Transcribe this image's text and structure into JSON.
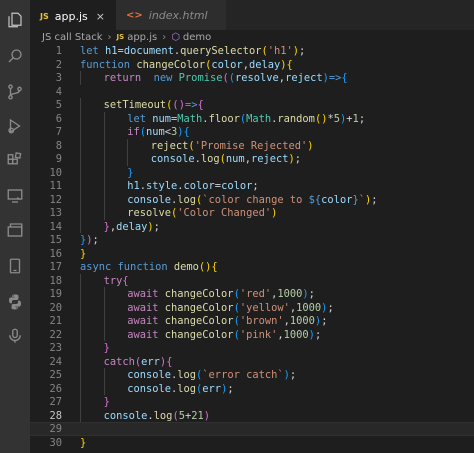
{
  "tabs": [
    {
      "label": "app.js",
      "icon": "JS",
      "close": "×",
      "active": true
    },
    {
      "label": "index.html",
      "icon": "<>",
      "active": false
    }
  ],
  "breadcrumb": {
    "folder": "JS call Stack",
    "sep": "›",
    "file_icon": "JS",
    "file": "app.js",
    "symbol": "demo"
  },
  "activity_icons": [
    "files-icon",
    "search-icon",
    "source-control-icon",
    "run-debug-icon",
    "extensions-icon",
    "remote-explorer-icon",
    "docker-icon",
    "device-icon",
    "python-icon",
    "microphone-icon"
  ],
  "editor": {
    "current_line": 28,
    "lines": [
      {
        "n": 1,
        "indent": 0,
        "tokens": [
          [
            "k",
            "let "
          ],
          [
            "v",
            "h1"
          ],
          [
            "p",
            "="
          ],
          [
            "v",
            "document"
          ],
          [
            "p",
            "."
          ],
          [
            "f",
            "querySelector"
          ],
          [
            "y",
            "("
          ],
          [
            "s",
            "'h1'"
          ],
          [
            "y",
            ")"
          ],
          [
            "p",
            ";"
          ]
        ]
      },
      {
        "n": 2,
        "indent": 0,
        "tokens": [
          [
            "k",
            "function "
          ],
          [
            "f",
            "changeColor"
          ],
          [
            "y",
            "("
          ],
          [
            "v",
            "color"
          ],
          [
            "p",
            ","
          ],
          [
            "v",
            "delay"
          ],
          [
            "y",
            ")"
          ],
          [
            "y",
            "{"
          ]
        ]
      },
      {
        "n": 3,
        "indent": 1,
        "tokens": [
          [
            "c",
            "return  "
          ],
          [
            "k",
            "new "
          ],
          [
            "t",
            "Promise"
          ],
          [
            "pm",
            "("
          ],
          [
            "bl",
            "("
          ],
          [
            "v",
            "resolve"
          ],
          [
            "p",
            ","
          ],
          [
            "v",
            "reject"
          ],
          [
            "bl",
            ")"
          ],
          [
            "k",
            "=>"
          ],
          [
            "bl",
            "{"
          ]
        ]
      },
      {
        "n": 4,
        "indent": 0,
        "tokens": []
      },
      {
        "n": 5,
        "indent": 1,
        "tokens": [
          [
            "f",
            "setTimeout"
          ],
          [
            "y",
            "("
          ],
          [
            "pm",
            "("
          ],
          [
            "pm",
            ")"
          ],
          [
            "k",
            "=>"
          ],
          [
            "pm",
            "{"
          ]
        ]
      },
      {
        "n": 6,
        "indent": 2,
        "tokens": [
          [
            "k",
            "let "
          ],
          [
            "v",
            "num"
          ],
          [
            "p",
            "="
          ],
          [
            "t",
            "Math"
          ],
          [
            "p",
            "."
          ],
          [
            "f",
            "floor"
          ],
          [
            "bl",
            "("
          ],
          [
            "t",
            "Math"
          ],
          [
            "p",
            "."
          ],
          [
            "f",
            "random"
          ],
          [
            "y",
            "("
          ],
          [
            "y",
            ")"
          ],
          [
            "p",
            "*"
          ],
          [
            "n",
            "5"
          ],
          [
            "bl",
            ")"
          ],
          [
            "p",
            "+"
          ],
          [
            "n",
            "1"
          ],
          [
            "p",
            ";"
          ]
        ]
      },
      {
        "n": 7,
        "indent": 2,
        "tokens": [
          [
            "c",
            "if"
          ],
          [
            "bl",
            "("
          ],
          [
            "v",
            "num"
          ],
          [
            "p",
            "<"
          ],
          [
            "n",
            "3"
          ],
          [
            "bl",
            ")"
          ],
          [
            "bl",
            "{"
          ]
        ]
      },
      {
        "n": 8,
        "indent": 3,
        "tokens": [
          [
            "f",
            "reject"
          ],
          [
            "y",
            "("
          ],
          [
            "s",
            "'Promise Rejected'"
          ],
          [
            "y",
            ")"
          ]
        ]
      },
      {
        "n": 9,
        "indent": 3,
        "tokens": [
          [
            "v",
            "console"
          ],
          [
            "p",
            "."
          ],
          [
            "f",
            "log"
          ],
          [
            "y",
            "("
          ],
          [
            "v",
            "num"
          ],
          [
            "p",
            ","
          ],
          [
            "v",
            "reject"
          ],
          [
            "y",
            ")"
          ],
          [
            "p",
            ";"
          ]
        ]
      },
      {
        "n": 10,
        "indent": 2,
        "tokens": [
          [
            "bl",
            "}"
          ]
        ]
      },
      {
        "n": 11,
        "indent": 2,
        "tokens": [
          [
            "v",
            "h1"
          ],
          [
            "p",
            "."
          ],
          [
            "v",
            "style"
          ],
          [
            "p",
            "."
          ],
          [
            "v",
            "color"
          ],
          [
            "p",
            "="
          ],
          [
            "v",
            "color"
          ],
          [
            "p",
            ";"
          ]
        ]
      },
      {
        "n": 12,
        "indent": 2,
        "tokens": [
          [
            "v",
            "console"
          ],
          [
            "p",
            "."
          ],
          [
            "f",
            "log"
          ],
          [
            "y",
            "("
          ],
          [
            "s",
            "`color change to "
          ],
          [
            "k",
            "${"
          ],
          [
            "v",
            "color"
          ],
          [
            "k",
            "}"
          ],
          [
            "s",
            "`"
          ],
          [
            "y",
            ")"
          ],
          [
            "p",
            ";"
          ]
        ]
      },
      {
        "n": 13,
        "indent": 2,
        "tokens": [
          [
            "f",
            "resolve"
          ],
          [
            "y",
            "("
          ],
          [
            "s",
            "'Color Changed'"
          ],
          [
            "y",
            ")"
          ]
        ]
      },
      {
        "n": 14,
        "indent": 1,
        "tokens": [
          [
            "pm",
            "}"
          ],
          [
            "p",
            ","
          ],
          [
            "v",
            "delay"
          ],
          [
            "y",
            ")"
          ],
          [
            "p",
            ";"
          ]
        ]
      },
      {
        "n": 15,
        "indent": 0,
        "tokens": [
          [
            "bl",
            "}"
          ],
          [
            "pm",
            ")"
          ],
          [
            "p",
            ";"
          ]
        ]
      },
      {
        "n": 16,
        "indent": 0,
        "tokens": [
          [
            "y",
            "}"
          ]
        ]
      },
      {
        "n": 17,
        "indent": 0,
        "tokens": [
          [
            "k",
            "async "
          ],
          [
            "k",
            "function "
          ],
          [
            "f",
            "demo"
          ],
          [
            "y",
            "("
          ],
          [
            "y",
            ")"
          ],
          [
            "y",
            "{"
          ]
        ]
      },
      {
        "n": 18,
        "indent": 1,
        "tokens": [
          [
            "c",
            "try"
          ],
          [
            "pm",
            "{"
          ]
        ]
      },
      {
        "n": 19,
        "indent": 2,
        "tokens": [
          [
            "c",
            "await "
          ],
          [
            "f",
            "changeColor"
          ],
          [
            "bl",
            "("
          ],
          [
            "s",
            "'red'"
          ],
          [
            "p",
            ","
          ],
          [
            "n",
            "1000"
          ],
          [
            "bl",
            ")"
          ],
          [
            "p",
            ";"
          ]
        ]
      },
      {
        "n": 20,
        "indent": 2,
        "tokens": [
          [
            "c",
            "await "
          ],
          [
            "f",
            "changeColor"
          ],
          [
            "bl",
            "("
          ],
          [
            "s",
            "'yellow'"
          ],
          [
            "p",
            ","
          ],
          [
            "n",
            "1000"
          ],
          [
            "bl",
            ")"
          ],
          [
            "p",
            ";"
          ]
        ]
      },
      {
        "n": 21,
        "indent": 2,
        "tokens": [
          [
            "c",
            "await "
          ],
          [
            "f",
            "changeColor"
          ],
          [
            "bl",
            "("
          ],
          [
            "s",
            "'brown'"
          ],
          [
            "p",
            ","
          ],
          [
            "n",
            "1000"
          ],
          [
            "bl",
            ")"
          ],
          [
            "p",
            ";"
          ]
        ]
      },
      {
        "n": 22,
        "indent": 2,
        "tokens": [
          [
            "c",
            "await "
          ],
          [
            "f",
            "changeColor"
          ],
          [
            "bl",
            "("
          ],
          [
            "s",
            "'pink'"
          ],
          [
            "p",
            ","
          ],
          [
            "n",
            "1000"
          ],
          [
            "bl",
            ")"
          ],
          [
            "p",
            ";"
          ]
        ]
      },
      {
        "n": 23,
        "indent": 1,
        "tokens": [
          [
            "pm",
            "}"
          ]
        ]
      },
      {
        "n": 24,
        "indent": 1,
        "tokens": [
          [
            "c",
            "catch"
          ],
          [
            "pm",
            "("
          ],
          [
            "v",
            "err"
          ],
          [
            "pm",
            ")"
          ],
          [
            "pm",
            "{"
          ]
        ]
      },
      {
        "n": 25,
        "indent": 2,
        "tokens": [
          [
            "v",
            "console"
          ],
          [
            "p",
            "."
          ],
          [
            "f",
            "log"
          ],
          [
            "bl",
            "("
          ],
          [
            "s",
            "`error catch`"
          ],
          [
            "bl",
            ")"
          ],
          [
            "p",
            ";"
          ]
        ]
      },
      {
        "n": 26,
        "indent": 2,
        "tokens": [
          [
            "v",
            "console"
          ],
          [
            "p",
            "."
          ],
          [
            "f",
            "log"
          ],
          [
            "bl",
            "("
          ],
          [
            "v",
            "err"
          ],
          [
            "bl",
            ")"
          ],
          [
            "p",
            ";"
          ]
        ]
      },
      {
        "n": 27,
        "indent": 1,
        "tokens": [
          [
            "pm",
            "}"
          ]
        ]
      },
      {
        "n": 28,
        "indent": 1,
        "tokens": [
          [
            "v",
            "console"
          ],
          [
            "p",
            "."
          ],
          [
            "f",
            "log"
          ],
          [
            "pm",
            "("
          ],
          [
            "n",
            "5"
          ],
          [
            "p",
            "+"
          ],
          [
            "n",
            "21"
          ],
          [
            "pm",
            ")"
          ]
        ]
      },
      {
        "n": 29,
        "indent": 0,
        "tokens": []
      },
      {
        "n": 30,
        "indent": 0,
        "tokens": [
          [
            "y",
            "}"
          ]
        ]
      }
    ]
  }
}
